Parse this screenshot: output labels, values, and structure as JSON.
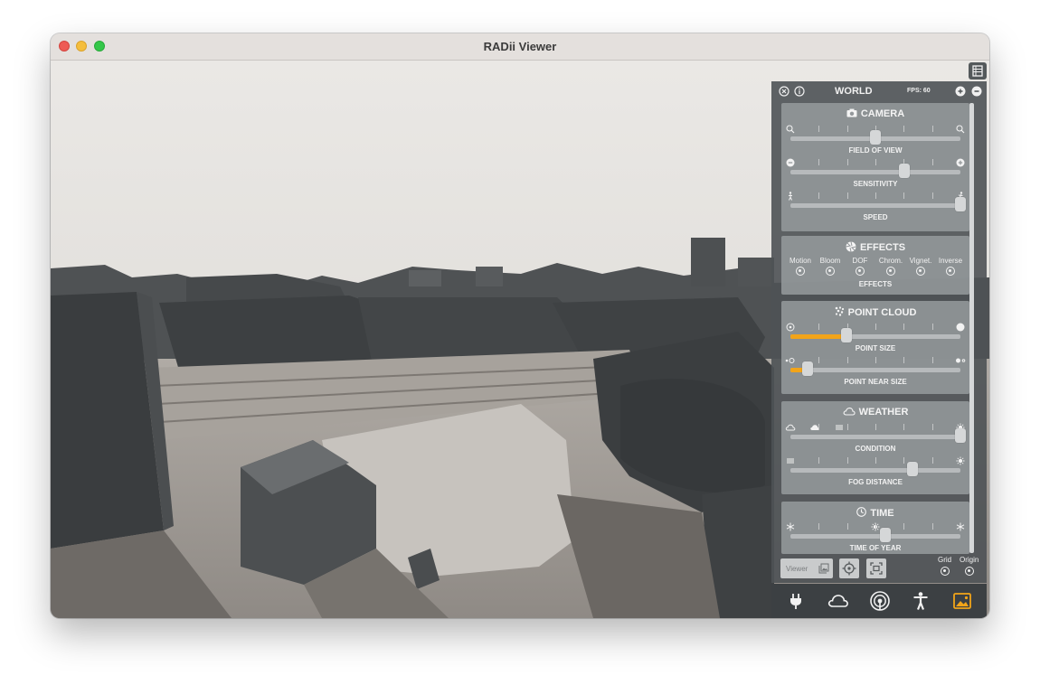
{
  "window": {
    "title": "RADii Viewer"
  },
  "panel": {
    "title": "WORLD",
    "fps": "FPS: 60",
    "camera": {
      "title": "CAMERA",
      "sliders": [
        {
          "label": "FIELD OF VIEW",
          "value": 0.5
        },
        {
          "label": "SENSITIVITY",
          "value": 0.67
        },
        {
          "label": "SPEED",
          "value": 1.0
        }
      ]
    },
    "effects": {
      "title": "EFFECTS",
      "options": [
        "Motion",
        "Bloom",
        "DOF",
        "Chrom.",
        "Vignet.",
        "Inverse"
      ],
      "label": "EFFECTS"
    },
    "point_cloud": {
      "title": "POINT CLOUD",
      "sliders": [
        {
          "label": "POINT SIZE",
          "value": 0.33
        },
        {
          "label": "POINT NEAR SIZE",
          "value": 0.1
        }
      ],
      "accent": "#f2a419"
    },
    "weather": {
      "title": "WEATHER",
      "sliders": [
        {
          "label": "CONDITION",
          "value": 1.0
        },
        {
          "label": "FOG DISTANCE",
          "value": 0.72
        }
      ]
    },
    "time": {
      "title": "TIME",
      "sliders": [
        {
          "label": "TIME OF YEAR",
          "value": 0.56
        }
      ]
    },
    "bottom": {
      "viewer_label": "Viewer",
      "grid_label": "Grid",
      "origin_label": "Origin"
    }
  },
  "dock": {
    "icons": [
      "plug-icon",
      "cloud-icon",
      "broadcast-icon",
      "person-icon",
      "image-icon"
    ],
    "active_color": "#f2a419"
  }
}
